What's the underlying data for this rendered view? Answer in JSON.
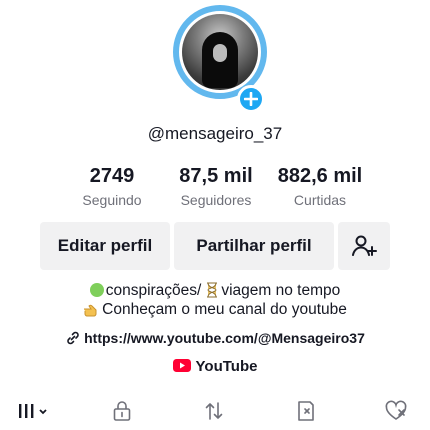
{
  "profile": {
    "username": "@mensageiro_37",
    "avatar": "avatar"
  },
  "stats": [
    {
      "value": "2749",
      "label": "Seguindo"
    },
    {
      "value": "87,5 mil",
      "label": "Seguidores"
    },
    {
      "value": "882,6 mil",
      "label": "Curtidas"
    }
  ],
  "actions": {
    "edit_label": "Editar perfil",
    "share_label": "Partilhar perfil",
    "add_friend_icon": "add-user-icon"
  },
  "bio": {
    "line1_part1": "conspirações/",
    "line1_part2": "viagem no tempo",
    "line2": "Conheçam o meu canal do youtube",
    "link": "https://www.youtube.com/@Mensageiro37",
    "youtube": "YouTube"
  },
  "colors": {
    "accent": "#1ea7f3",
    "ring": "#62b8ee",
    "youtube_red": "#ff0033",
    "button_bg": "#f1f1f2"
  },
  "tabs": [
    "grid-menu-icon",
    "lock-icon",
    "repost-icon",
    "bookmark-icon",
    "liked-icon"
  ]
}
